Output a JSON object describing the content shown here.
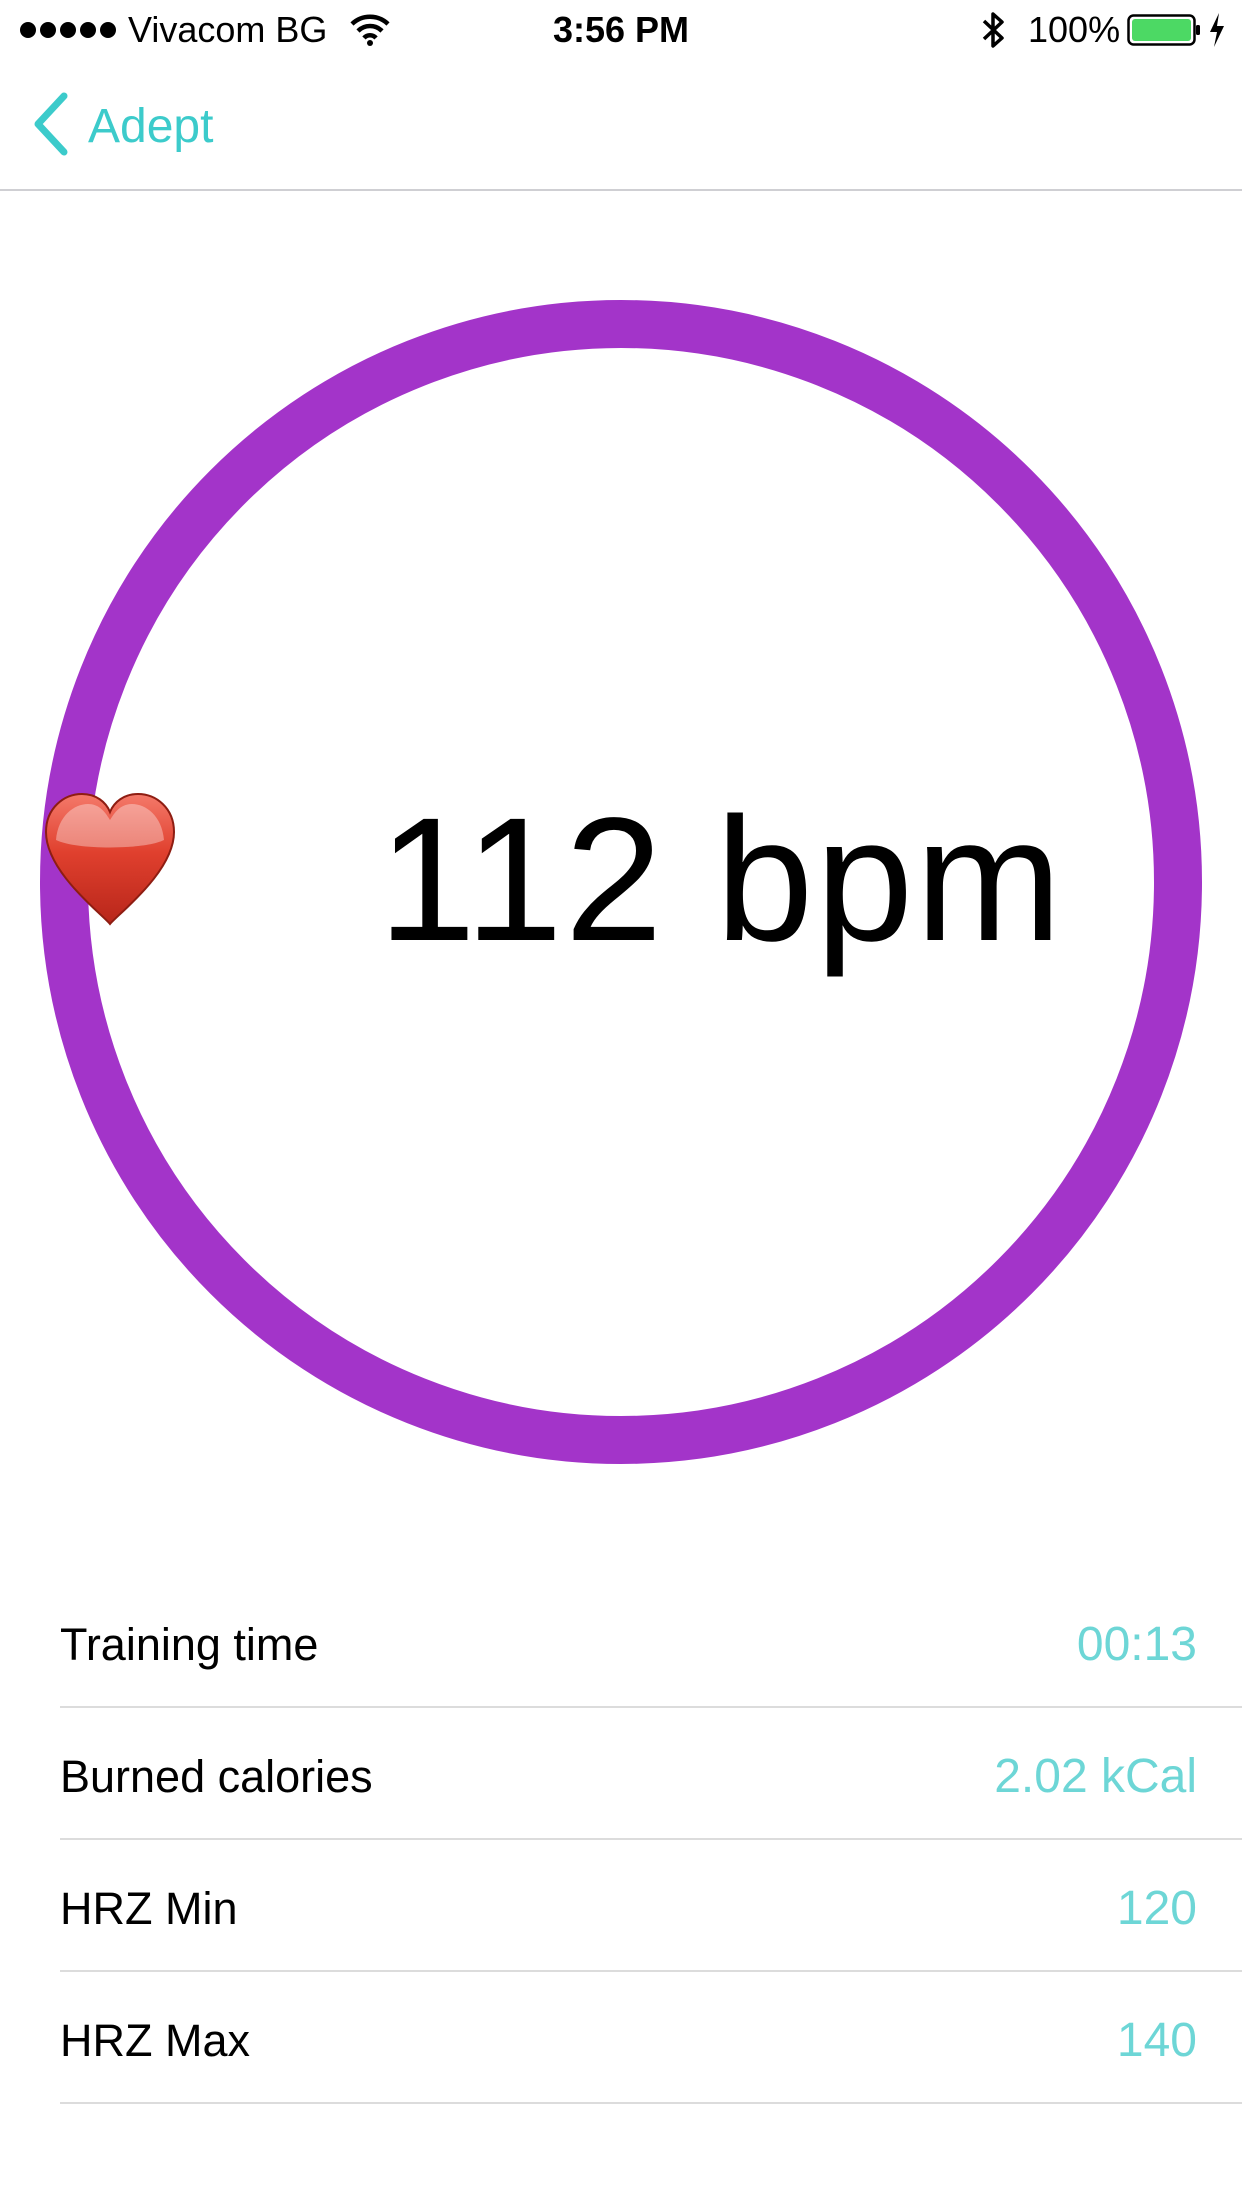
{
  "status_bar": {
    "carrier": "Vivacom BG",
    "time": "3:56 PM",
    "battery_percent": "100%",
    "signal_dots": 5,
    "icons": [
      "signal-dots",
      "wifi-icon",
      "bluetooth-icon",
      "battery-icon",
      "charging-icon"
    ]
  },
  "nav": {
    "back_label": "Adept",
    "back_icon": "chevron-left-icon"
  },
  "heart_rate": {
    "value": "112 bpm",
    "icon": "heart-icon"
  },
  "stats": [
    {
      "label": "Training time",
      "value": "00:13"
    },
    {
      "label": "Burned calories",
      "value": "2.02 kCal"
    },
    {
      "label": "HRZ Min",
      "value": "120"
    },
    {
      "label": "HRZ Max",
      "value": "140"
    }
  ],
  "colors": {
    "accent": "#3ccbcb",
    "stat_value": "#6dd6d6",
    "ring": "#a334c9",
    "battery_fill": "#4cd964",
    "heart": "#d63a2a"
  }
}
